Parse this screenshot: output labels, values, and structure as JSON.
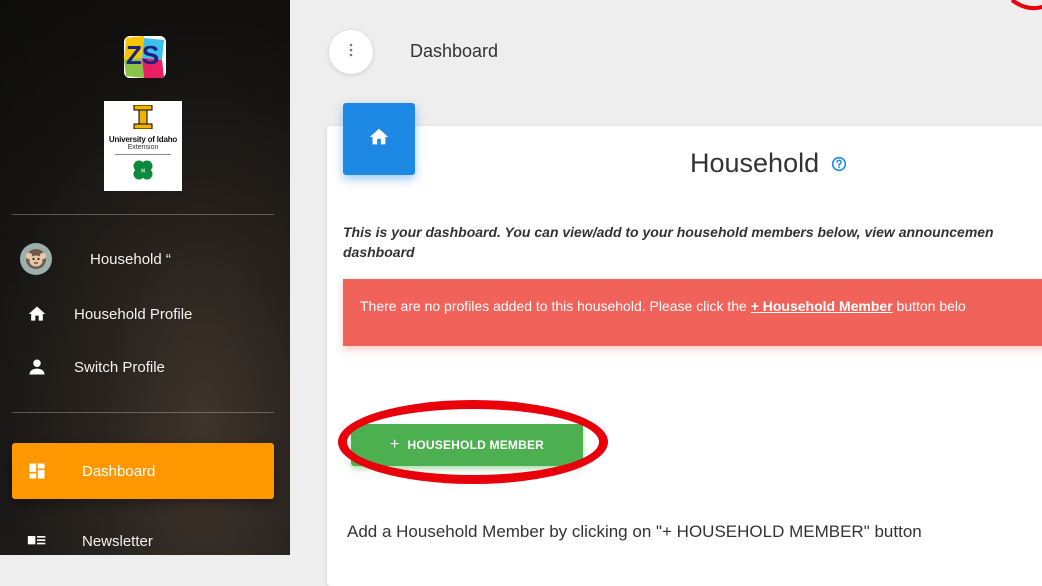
{
  "topbar": {
    "menu_icon": "more-vertical-icon",
    "title": "Dashboard"
  },
  "sidebar": {
    "user": {
      "label": "Household “",
      "avatar_icon": "monkey-avatar-icon"
    },
    "logos": {
      "zs": "ZS",
      "university_mark": "I",
      "university_name": "University of Idaho",
      "university_sub": "Extension"
    },
    "items": [
      {
        "label": "Household Profile",
        "icon": "home-icon"
      },
      {
        "label": "Switch Profile",
        "icon": "person-icon"
      },
      {
        "label": "Dashboard",
        "icon": "dashboard-icon",
        "active": true
      },
      {
        "label": "Newsletter",
        "icon": "newsletter-icon"
      }
    ]
  },
  "card": {
    "icon": "home-icon",
    "title": "Household",
    "help_icon": "help-circle-icon",
    "description_line1": "This is your dashboard. You can view/add to your household members below, view announcemen",
    "description_line2": "dashboard",
    "alert": {
      "text_before": "There are no profiles added to this household. Please click the ",
      "link": "+ Household Member",
      "text_after": " button belo"
    },
    "add_button": {
      "label": "HOUSEHOLD MEMBER",
      "icon": "plus-icon",
      "plus": "+"
    },
    "hint": "Add a Household Member by clicking on \"+ HOUSEHOLD MEMBER\" button"
  },
  "colors": {
    "accent_orange": "#ff9800",
    "accent_blue": "#1e88e5",
    "alert_red": "#f0625a",
    "button_green": "#4caf50",
    "annotation_red": "#e8000b"
  }
}
